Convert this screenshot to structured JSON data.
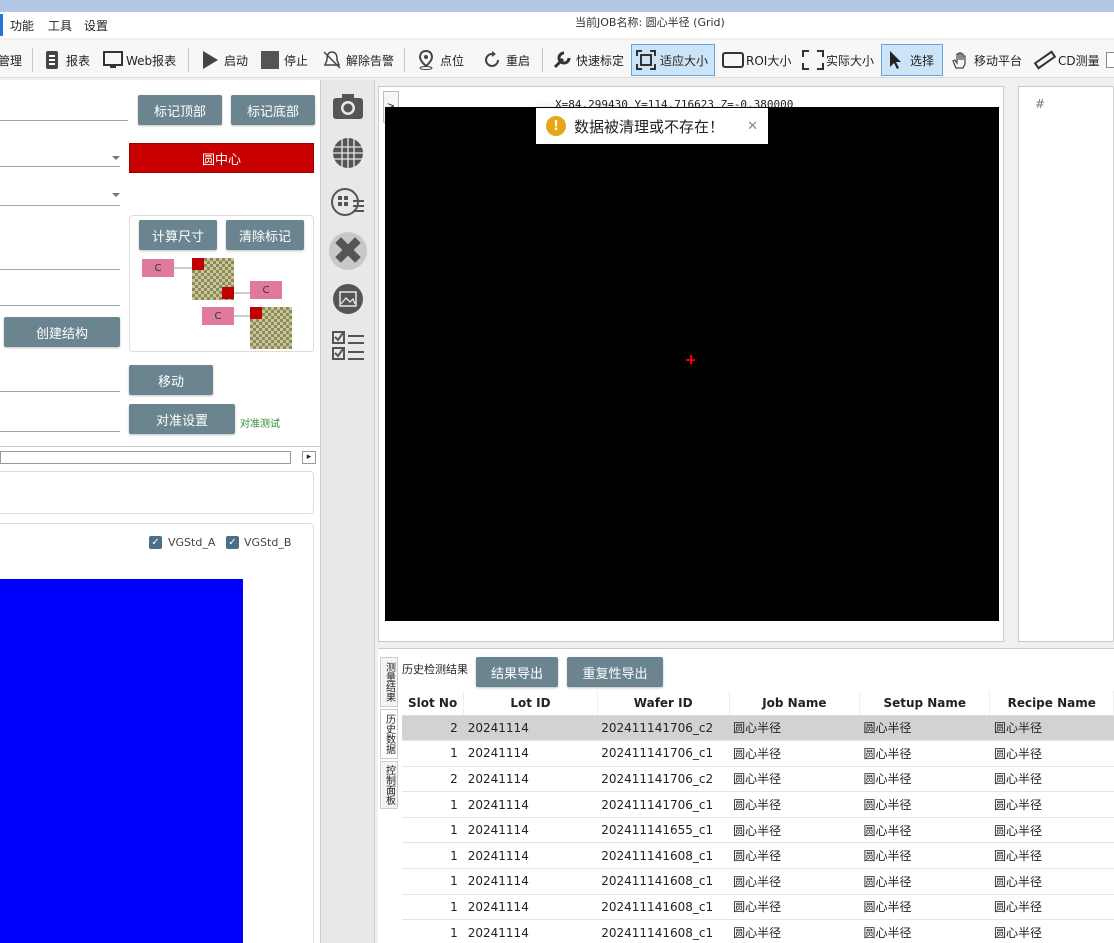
{
  "menu": {
    "items": [
      "功能",
      "工具",
      "设置"
    ],
    "job_title": "当前JOB名称: 圆心半径 (Grid)"
  },
  "toolbar": {
    "items": [
      {
        "label": "管理",
        "icon": "manage-icon"
      },
      {
        "label": "报表",
        "icon": "report-icon"
      },
      {
        "label": "Web报表",
        "icon": "web-report-icon"
      },
      {
        "label": "启动",
        "icon": "play-icon"
      },
      {
        "label": "停止",
        "icon": "stop-icon"
      },
      {
        "label": "解除告警",
        "icon": "alarm-off-icon"
      },
      {
        "label": "点位",
        "icon": "location-icon"
      },
      {
        "label": "重启",
        "icon": "restart-icon"
      },
      {
        "label": "快速标定",
        "icon": "wrench-icon"
      },
      {
        "label": "适应大小",
        "icon": "fit-icon"
      },
      {
        "label": "ROI大小",
        "icon": "roi-icon"
      },
      {
        "label": "实际大小",
        "icon": "actual-size-icon"
      },
      {
        "label": "选择",
        "icon": "cursor-icon"
      },
      {
        "label": "移动平台",
        "icon": "hand-icon"
      },
      {
        "label": "CD测量",
        "icon": "ruler-icon"
      }
    ]
  },
  "left": {
    "mark_top": "标记顶部",
    "mark_bottom": "标记底部",
    "circle_center": "圆中心",
    "calc_size": "计算尺寸",
    "clear_marks": "清除标记",
    "c_label": "C",
    "create_structure": "创建结构",
    "move": "移动",
    "align_settings": "对准设置",
    "align_test": "对准测试",
    "checkbox_a": "VGStd_A",
    "checkbox_b": "VGStd_B",
    "scroll_arrow": "▸"
  },
  "viewer": {
    "coords": "X=84.299430 Y=114.716623 Z=-0.380000",
    "toast": "数据被清理或不存在！",
    "toast_close": "✕",
    "expand": ">",
    "right_header": "#"
  },
  "bottom": {
    "history_label": "历史检测结果",
    "export_results": "结果导出",
    "export_repeat": "重复性导出",
    "tabs": [
      "测量结果",
      "历史数据",
      "控制面板"
    ],
    "columns": [
      "Slot No",
      "Lot ID",
      "Wafer ID",
      "Job Name",
      "Setup Name",
      "Recipe Name"
    ],
    "rows": [
      [
        "2",
        "20241114",
        "202411141706_c2",
        "圆心半径",
        "圆心半径",
        "圆心半径"
      ],
      [
        "1",
        "20241114",
        "202411141706_c1",
        "圆心半径",
        "圆心半径",
        "圆心半径"
      ],
      [
        "2",
        "20241114",
        "202411141706_c2",
        "圆心半径",
        "圆心半径",
        "圆心半径"
      ],
      [
        "1",
        "20241114",
        "202411141706_c1",
        "圆心半径",
        "圆心半径",
        "圆心半径"
      ],
      [
        "1",
        "20241114",
        "202411141655_c1",
        "圆心半径",
        "圆心半径",
        "圆心半径"
      ],
      [
        "1",
        "20241114",
        "202411141608_c1",
        "圆心半径",
        "圆心半径",
        "圆心半径"
      ],
      [
        "1",
        "20241114",
        "202411141608_c1",
        "圆心半径",
        "圆心半径",
        "圆心半径"
      ],
      [
        "1",
        "20241114",
        "202411141608_c1",
        "圆心半径",
        "圆心半径",
        "圆心半径"
      ],
      [
        "1",
        "20241114",
        "202411141608_c1",
        "圆心半径",
        "圆心半径",
        "圆心半径"
      ]
    ]
  },
  "colors": {
    "accent": "#1e78d7",
    "button": "#6b8590",
    "danger": "#c80000",
    "blue_area": "#0000ff"
  }
}
